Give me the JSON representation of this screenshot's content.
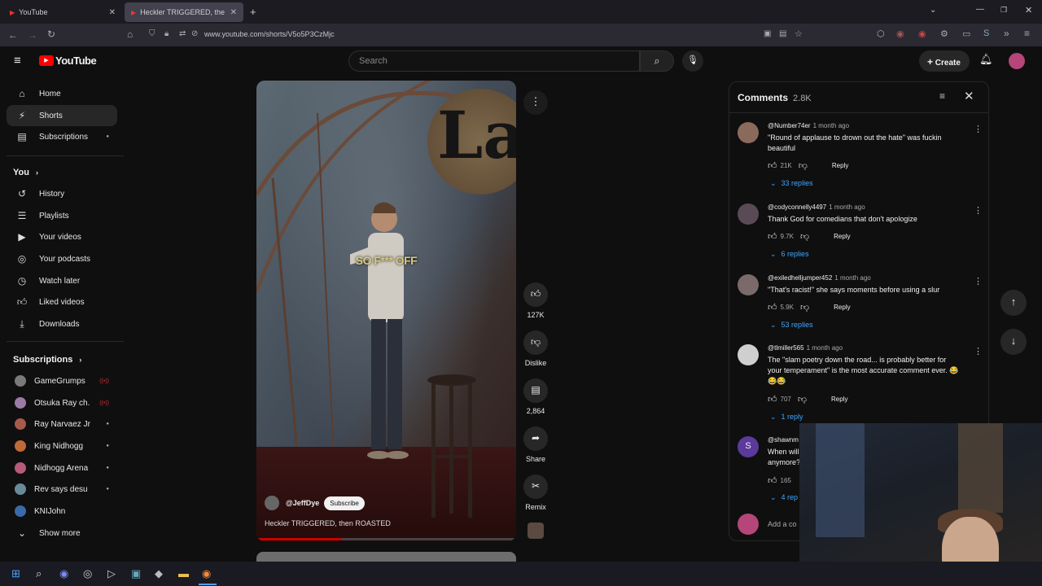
{
  "browser": {
    "tabs": [
      {
        "label": "YouTube",
        "active": false
      },
      {
        "label": "Heckler TRIGGERED, then R",
        "active": true
      }
    ],
    "url": "www.youtube.com/shorts/V5o5P3CzMjc"
  },
  "header": {
    "logo": "YouTube",
    "search_placeholder": "Search",
    "create_label": "Create"
  },
  "sidebar": {
    "main_items": [
      {
        "label": "Home",
        "icon": "home-icon"
      },
      {
        "label": "Shorts",
        "icon": "shorts-icon"
      },
      {
        "label": "Subscriptions",
        "icon": "subscriptions-icon"
      }
    ],
    "you_heading": "You",
    "you_items": [
      {
        "label": "History",
        "icon": "history-icon"
      },
      {
        "label": "Playlists",
        "icon": "playlists-icon"
      },
      {
        "label": "Your videos",
        "icon": "your-videos-icon"
      },
      {
        "label": "Your podcasts",
        "icon": "podcasts-icon"
      },
      {
        "label": "Watch later",
        "icon": "watch-later-icon"
      },
      {
        "label": "Liked videos",
        "icon": "liked-icon"
      },
      {
        "label": "Downloads",
        "icon": "downloads-icon"
      }
    ],
    "subs_heading": "Subscriptions",
    "subscriptions": [
      {
        "label": "GameGrumps",
        "color": "#7a7a7a",
        "live": true
      },
      {
        "label": "Otsuka Ray ch.",
        "color": "#9b7aa8",
        "live": true
      },
      {
        "label": "Ray Narvaez Jr",
        "color": "#a65a4a",
        "live": false
      },
      {
        "label": "King Nidhogg",
        "color": "#c06a3a",
        "live": false
      },
      {
        "label": "Nidhogg Arena",
        "color": "#b85a7a",
        "live": false
      },
      {
        "label": "Rev says desu",
        "color": "#6a8a9a",
        "live": false
      },
      {
        "label": "KNIJohn",
        "color": "#3a6aa8",
        "live": false
      }
    ],
    "show_more": "Show more"
  },
  "video": {
    "caption": "SO F*** OFF",
    "logo_text": "La",
    "channel": "@JeffDye",
    "subscribe_label": "Subscribe",
    "title": "Heckler TRIGGERED, then ROASTED",
    "progress": 0.33
  },
  "actions": {
    "likes": "127K",
    "dislike": "Dislike",
    "comments": "2,864",
    "share": "Share",
    "remix": "Remix"
  },
  "comments": {
    "title": "Comments",
    "count": "2.8K",
    "add_placeholder": "Add a co",
    "items": [
      {
        "author": "@Number74er",
        "time": "1 month ago",
        "text": "\"Round of applause to drown out the hate\" was fuckin beautiful",
        "likes": "21K",
        "reply": "Reply",
        "replies": "33 replies",
        "color": "#8a6a5a"
      },
      {
        "author": "@codyconnelly4497",
        "time": "1 month ago",
        "text": "Thank God for comedians that don't apologize",
        "likes": "9.7K",
        "reply": "Reply",
        "replies": "6 replies",
        "color": "#5a4a55"
      },
      {
        "author": "@exiledhelljumper452",
        "time": "1 month ago",
        "text": "\"That's racist!\" she says moments before using a slur",
        "likes": "5.9K",
        "reply": "Reply",
        "replies": "53 replies",
        "color": "#7a6a6a"
      },
      {
        "author": "@tlmiller565",
        "time": "1 month ago",
        "text": "The \"slam poetry down the road... is probably better for your temperament\" is the most accurate comment ever. 😂😂😂",
        "likes": "707",
        "reply": "Reply",
        "replies": "1 reply",
        "color": "#cfcfcf"
      },
      {
        "author": "@shawnm",
        "time": "",
        "text": "When will anymore?",
        "likes": "165",
        "reply": "",
        "replies": "4 rep",
        "color": "#5a3a9a"
      }
    ]
  }
}
